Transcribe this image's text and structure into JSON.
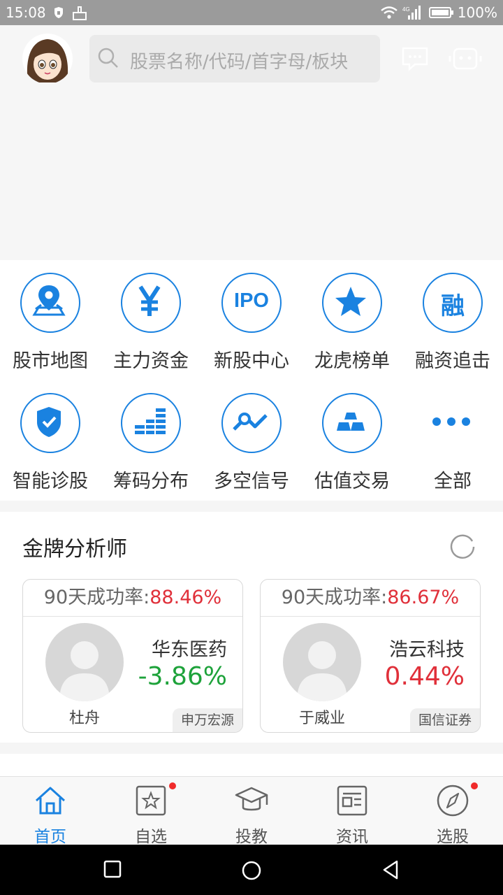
{
  "status_bar": {
    "time": "15:08",
    "battery": "100%",
    "network": "4G"
  },
  "search": {
    "placeholder": "股票名称/代码/首字母/板块"
  },
  "quick_menu": [
    {
      "label": "股市地图",
      "icon": "map-pin-icon"
    },
    {
      "label": "主力资金",
      "icon": "yen-icon"
    },
    {
      "label": "新股中心",
      "icon": "ipo-icon",
      "glyph": "IPO"
    },
    {
      "label": "龙虎榜单",
      "icon": "star-icon"
    },
    {
      "label": "融资追击",
      "icon": "margin-icon",
      "glyph": "融"
    },
    {
      "label": "智能诊股",
      "icon": "shield-check-icon"
    },
    {
      "label": "筹码分布",
      "icon": "chip-bars-icon"
    },
    {
      "label": "多空信号",
      "icon": "signal-line-icon"
    },
    {
      "label": "估值交易",
      "icon": "gold-bars-icon"
    },
    {
      "label": "全部",
      "icon": "more-icon"
    }
  ],
  "analysts": {
    "title": "金牌分析师",
    "cards": [
      {
        "rate_label": "90天成功率:",
        "rate": "88.46%",
        "name": "杜舟",
        "stock": "华东医药",
        "change": "-3.86%",
        "firm": "申万宏源",
        "direction": "down"
      },
      {
        "rate_label": "90天成功率:",
        "rate": "86.67%",
        "name": "于威业",
        "stock": "浩云科技",
        "change": "0.44%",
        "firm": "国信证券",
        "direction": "up"
      }
    ]
  },
  "tabs": [
    {
      "label": "首页",
      "icon": "home-icon",
      "active": true,
      "badge": false
    },
    {
      "label": "自选",
      "icon": "star-box-icon",
      "active": false,
      "badge": true
    },
    {
      "label": "投教",
      "icon": "graduation-cap-icon",
      "active": false,
      "badge": false
    },
    {
      "label": "资讯",
      "icon": "news-icon",
      "active": false,
      "badge": false
    },
    {
      "label": "选股",
      "icon": "compass-icon",
      "active": false,
      "badge": true
    }
  ],
  "colors": {
    "accent": "#1a82e0",
    "up": "#e0303a",
    "down": "#1da23a",
    "badge": "#f02b2b"
  }
}
